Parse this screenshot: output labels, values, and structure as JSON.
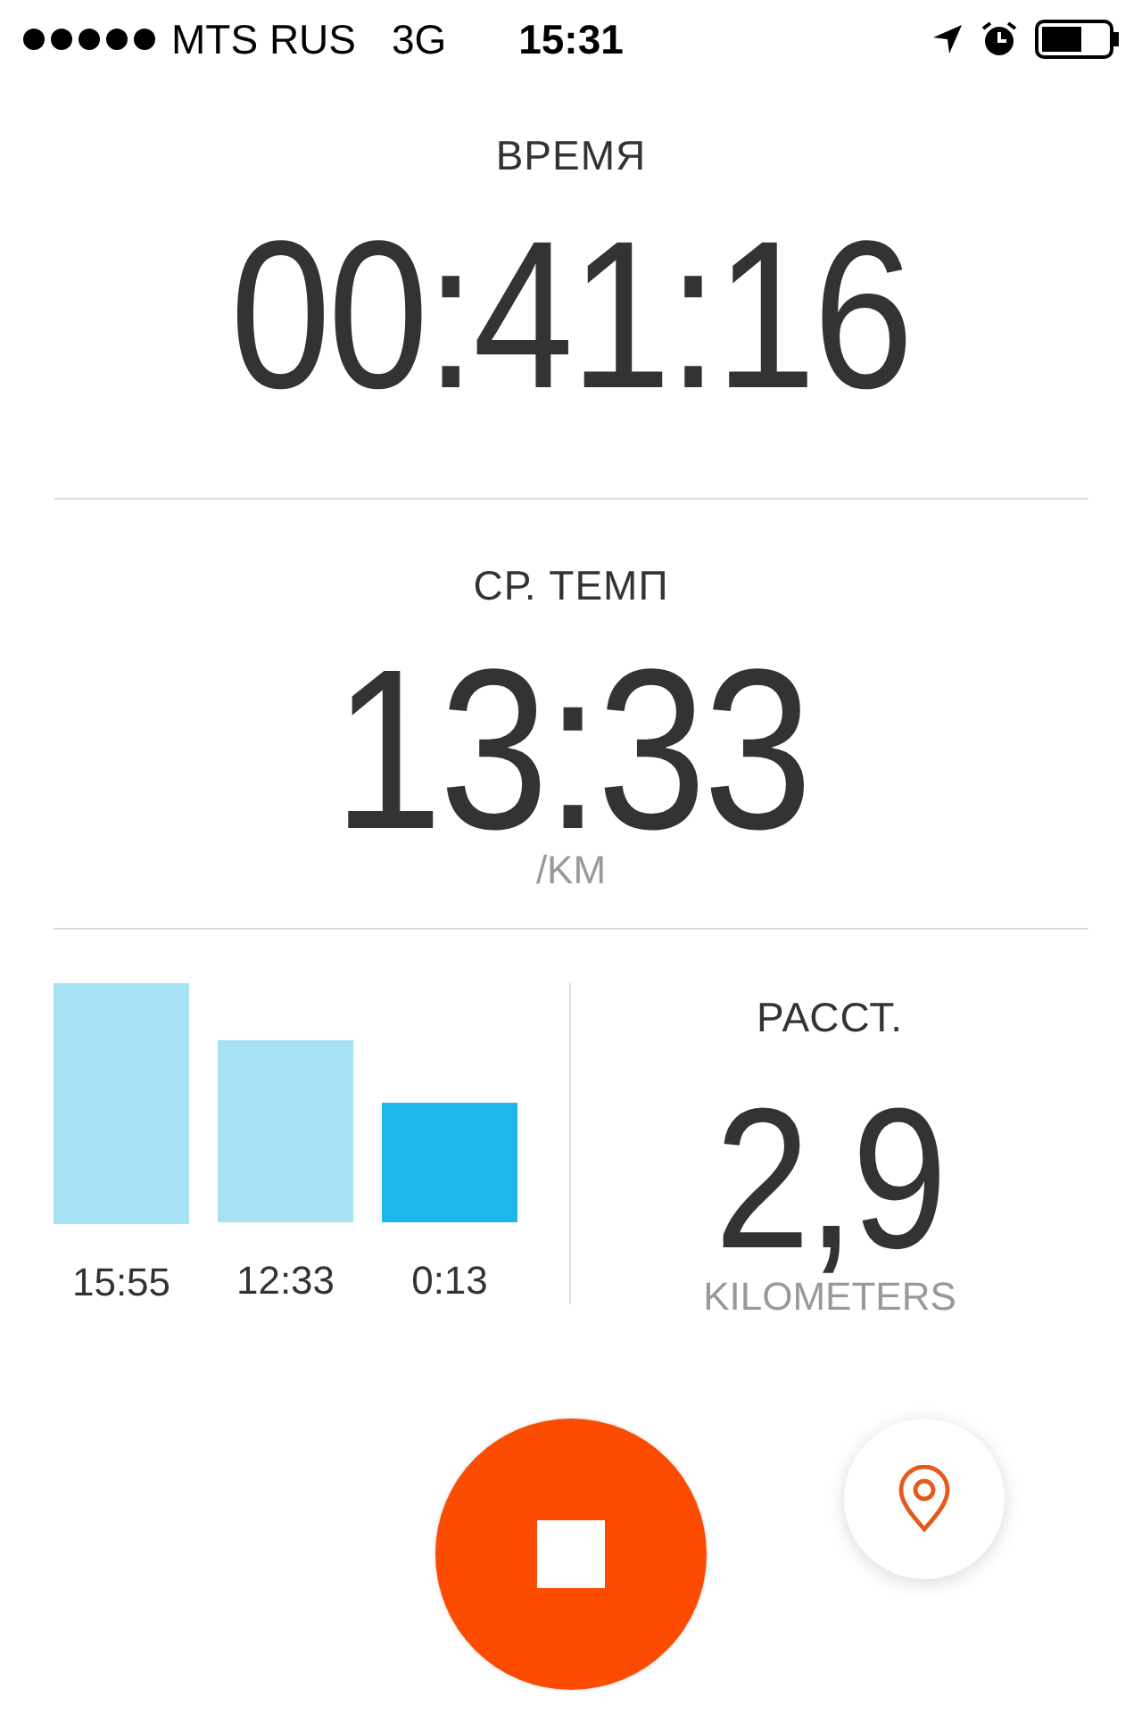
{
  "status_bar": {
    "carrier": "MTS RUS",
    "network": "3G",
    "time": "15:31"
  },
  "elapsed": {
    "label": "ВРЕМЯ",
    "value": "00:41:16"
  },
  "pace": {
    "label": "СР. ТЕМП",
    "value": "13:33",
    "unit": "/KM"
  },
  "splits": [
    {
      "label": "15:55",
      "selected": false
    },
    {
      "label": "12:33",
      "selected": false
    },
    {
      "label": "0:13",
      "selected": true
    }
  ],
  "distance": {
    "label": "РАССТ.",
    "value": "2,9",
    "unit": "KILOMETERS"
  }
}
